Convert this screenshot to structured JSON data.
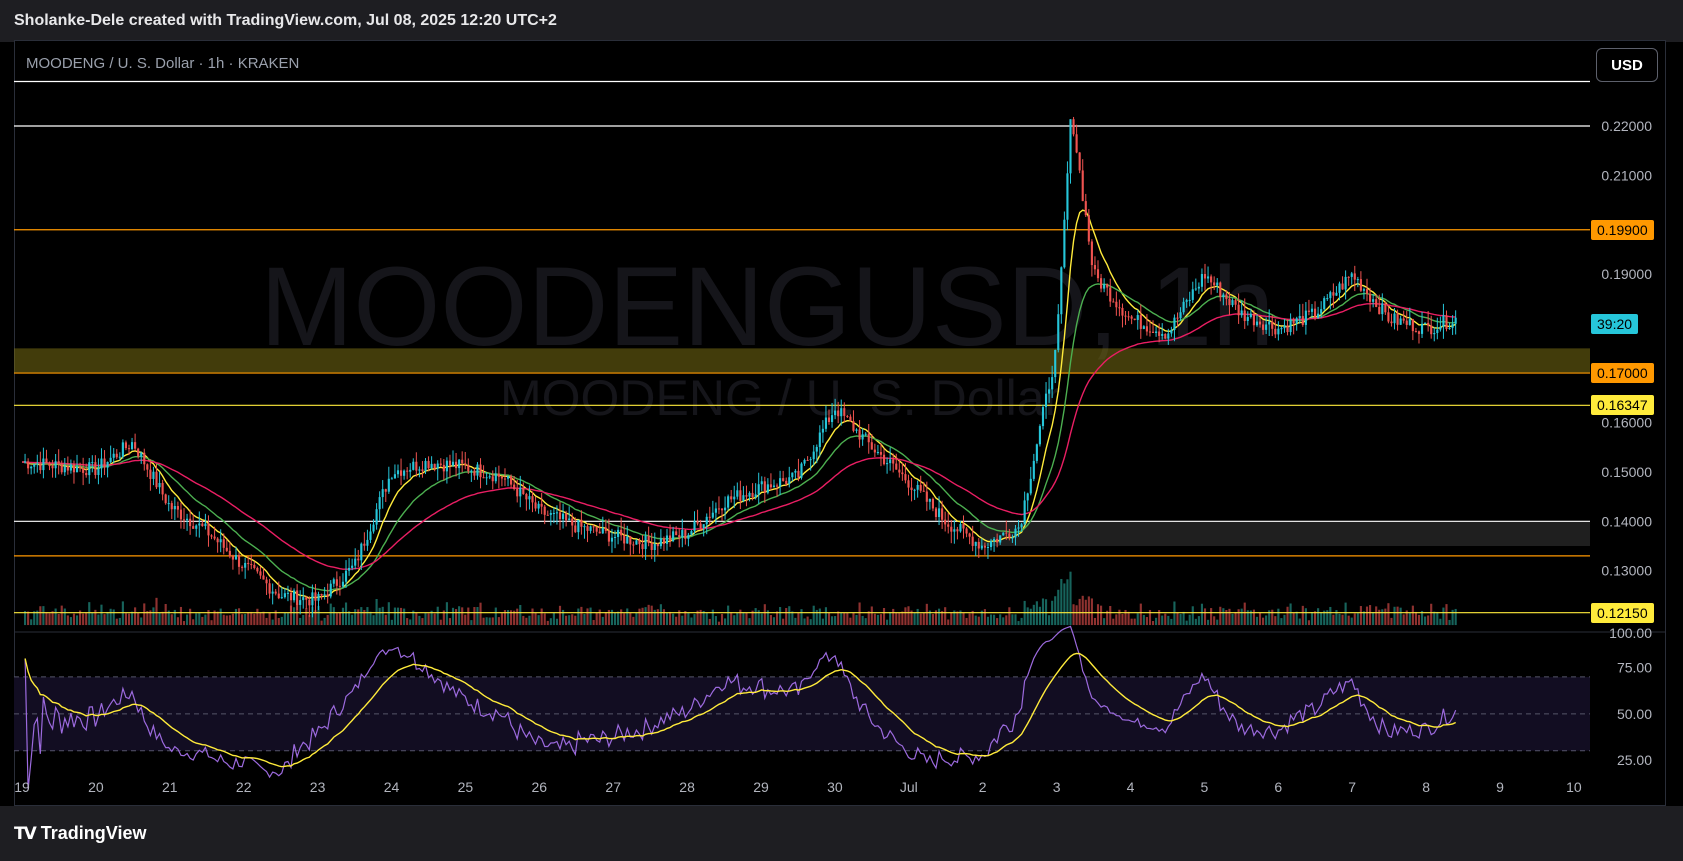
{
  "header": {
    "title": "Sholanke-Dele created with TradingView.com, Jul 08, 2025 12:20 UTC+2"
  },
  "toolbar": {
    "currency_label": "USD"
  },
  "symbol_legend": "MOODENG / U. S. Dollar · 1h · KRAKEN",
  "watermark": {
    "ticker": "MOODENGUSD, 1h",
    "description": "MOODENG / U. S. Dollar"
  },
  "branding": {
    "logo_text": "TradingView"
  },
  "colors": {
    "up": "#26c6da",
    "down": "#ef5350",
    "ema_fast": "#ffeb3b",
    "ema_mid": "#4caf50",
    "ema_slow": "#e91e63",
    "rsi": "#9c6ade",
    "rsi_ma": "#ffeb3b",
    "line_white": "#ffffff",
    "line_orange": "#ff9800",
    "line_yellow": "#ffeb3b"
  },
  "price_tags": [
    {
      "label": "0.19900",
      "style": "orange"
    },
    {
      "label": "39:20",
      "style": "cyan"
    },
    {
      "label": "0.17000",
      "style": "orange"
    },
    {
      "label": "0.16347",
      "style": "yellow"
    },
    {
      "label": "0.12150",
      "style": "yellow"
    }
  ],
  "chart_data": {
    "type": "candlestick",
    "interval": "1h",
    "price_axis": {
      "ticks": [
        "0.22000",
        "0.21000",
        "0.19000",
        "0.16000",
        "0.15000",
        "0.14000",
        "0.13000"
      ],
      "range": [
        0.118,
        0.237
      ]
    },
    "time_axis": {
      "ticks": [
        "19",
        "20",
        "21",
        "22",
        "23",
        "24",
        "25",
        "26",
        "27",
        "28",
        "29",
        "30",
        "Jul",
        "2",
        "3",
        "4",
        "5",
        "6",
        "7",
        "8",
        "9",
        "10"
      ]
    },
    "rsi_axis": {
      "ticks": [
        "75.00",
        "50.00",
        "25.00"
      ],
      "top_label": "100.00",
      "range": [
        25,
        90
      ],
      "band": [
        30,
        70
      ]
    },
    "approx_path": [
      [
        "19",
        0.152
      ],
      [
        "20",
        0.1505
      ],
      [
        "20.5",
        0.156
      ],
      [
        "21",
        0.143
      ],
      [
        "21.5",
        0.138
      ],
      [
        "22",
        0.131
      ],
      [
        "22.5",
        0.125
      ],
      [
        "23",
        0.124
      ],
      [
        "23.5",
        0.131
      ],
      [
        "24",
        0.15
      ],
      [
        "24.5",
        0.152
      ],
      [
        "25",
        0.151
      ],
      [
        "25.5",
        0.149
      ],
      [
        "26",
        0.142
      ],
      [
        "26.5",
        0.139
      ],
      [
        "27",
        0.137
      ],
      [
        "27.5",
        0.1355
      ],
      [
        "28",
        0.1375
      ],
      [
        "28.5",
        0.144
      ],
      [
        "29",
        0.147
      ],
      [
        "29.5",
        0.149
      ],
      [
        "30",
        0.163
      ],
      [
        "30.5",
        0.155
      ],
      [
        "Jul",
        0.148
      ],
      [
        "1.5",
        0.14
      ],
      [
        "2",
        0.135
      ],
      [
        "2.5",
        0.139
      ],
      [
        "3",
        0.175
      ],
      [
        "3.2",
        0.223
      ],
      [
        "3.5",
        0.19
      ],
      [
        "4",
        0.181
      ],
      [
        "4.5",
        0.178
      ],
      [
        "5",
        0.19
      ],
      [
        "5.5",
        0.182
      ],
      [
        "6",
        0.179
      ],
      [
        "6.5",
        0.182
      ],
      [
        "7",
        0.19
      ],
      [
        "7.5",
        0.181
      ],
      [
        "8",
        0.179
      ],
      [
        "8.4",
        0.181
      ]
    ],
    "horizontal_levels": [
      {
        "price": 0.229,
        "color": "white"
      },
      {
        "price": 0.22,
        "color": "white"
      },
      {
        "price": 0.199,
        "color": "orange",
        "label": "0.19900"
      },
      {
        "price": 0.17,
        "color": "orange",
        "label": "0.17000"
      },
      {
        "price": 0.16347,
        "color": "yellow",
        "label": "0.16347"
      },
      {
        "price": 0.14,
        "color": "white"
      },
      {
        "price": 0.133,
        "color": "orange"
      },
      {
        "price": 0.1215,
        "color": "yellow",
        "label": "0.12150"
      }
    ],
    "zones": [
      {
        "from": 0.17,
        "to": 0.175,
        "color": "olive"
      },
      {
        "from": 0.135,
        "to": 0.14,
        "color": "gray"
      }
    ],
    "current_price_countdown": "39:20"
  }
}
